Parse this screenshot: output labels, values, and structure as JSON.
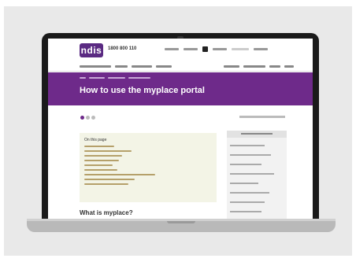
{
  "header": {
    "logo_text": "ndis",
    "phone": "1800 800 110"
  },
  "page": {
    "title": "How to use the myplace portal",
    "toc_title": "On this page",
    "section_heading": "What is myplace?"
  },
  "colors": {
    "brand": "#6e2a8a",
    "frame": "#e9e9e9"
  }
}
